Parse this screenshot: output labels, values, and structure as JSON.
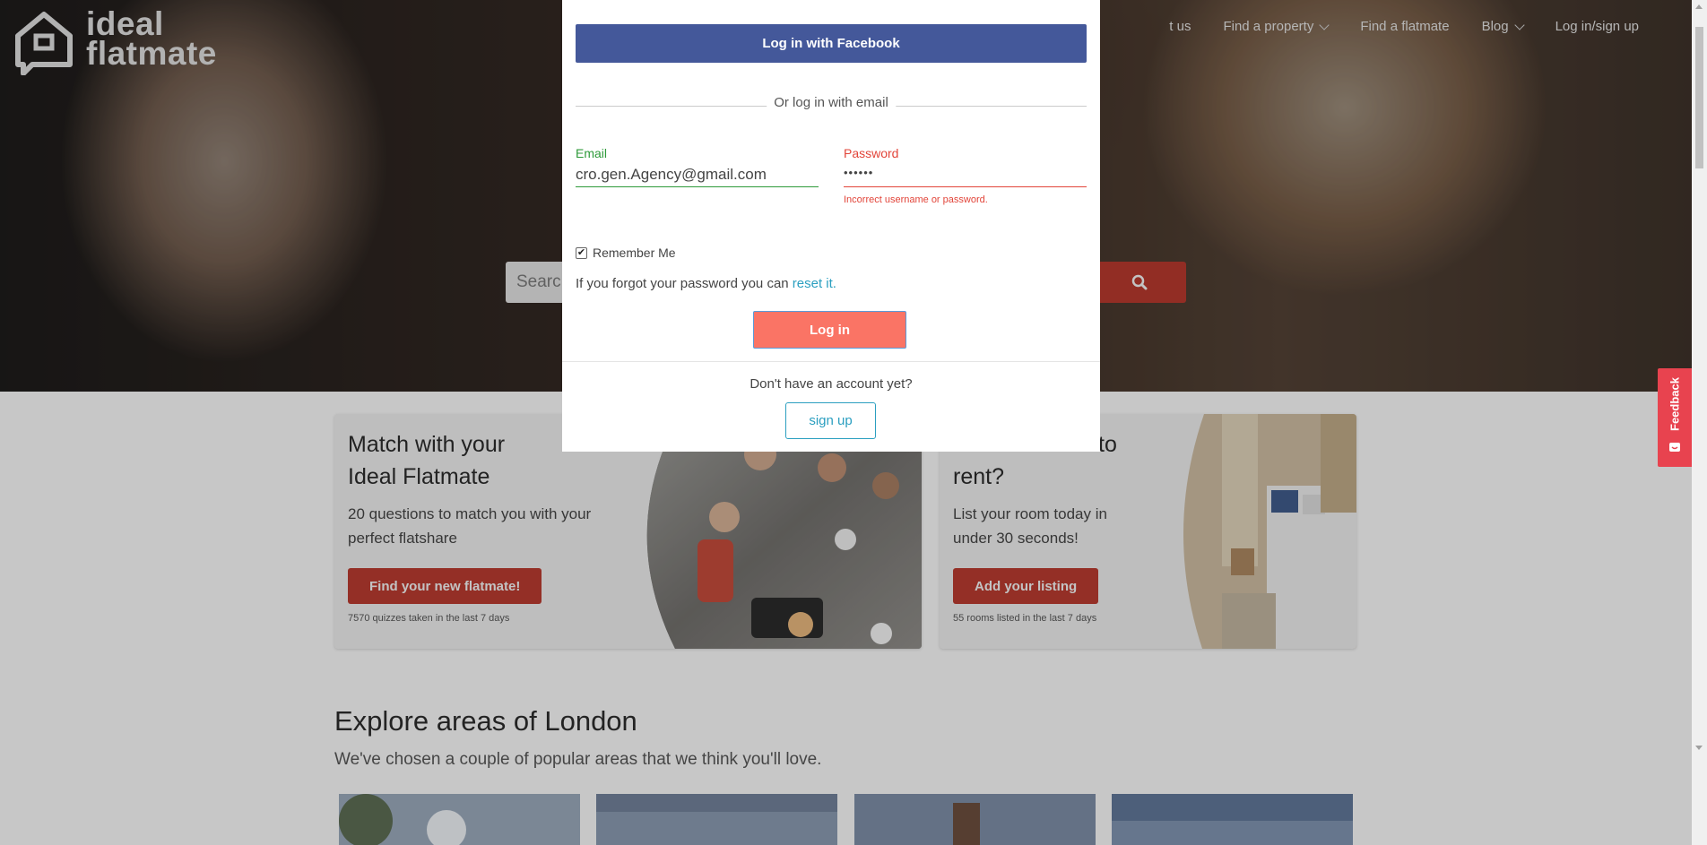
{
  "brand": {
    "logo_line1": "ideal",
    "logo_line2": "flatmate"
  },
  "nav": {
    "items": [
      {
        "label": "t us",
        "dropdown": false
      },
      {
        "label": "Find a property",
        "dropdown": true
      },
      {
        "label": "Find a flatmate",
        "dropdown": false
      },
      {
        "label": "Blog",
        "dropdown": true
      },
      {
        "label": "Log in/sign up",
        "dropdown": false
      }
    ]
  },
  "search": {
    "placeholder": "Searc"
  },
  "login_modal": {
    "facebook_label": "Log in with Facebook",
    "divider_text": "Or log in with email",
    "email_label": "Email",
    "email_value": "cro.gen.Agency@gmail.com",
    "password_label": "Password",
    "password_value": "••••••",
    "password_error": "Incorrect username or password.",
    "remember_label": "Remember Me",
    "remember_checked": true,
    "forgot_text": "If you forgot your password you can ",
    "forgot_link": "reset it.",
    "login_label": "Log in",
    "no_account_text": "Don't have an account yet?",
    "signup_label": "sign up"
  },
  "cards": [
    {
      "title_line1": "Match with your",
      "title_line2": "Ideal Flatmate",
      "desc_line1": "20 questions to match you with your",
      "desc_line2": "perfect flatshare",
      "button": "Find your new flatmate!",
      "note": "7570 quizzes taken in the last 7 days"
    },
    {
      "title_line1": "to",
      "title_line2": "rent?",
      "desc_line1": "List your room today in",
      "desc_line2": "under 30 seconds!",
      "button": "Add your listing",
      "note": "55 rooms listed in the last 7 days"
    }
  ],
  "explore": {
    "title": "Explore areas of London",
    "subtitle": "We've chosen a couple of popular areas that we think you'll love."
  },
  "feedback": {
    "label": "Feedback"
  },
  "colors": {
    "facebook": "#44589a",
    "login_button": "#fa7465",
    "accent_red": "#b53a2f",
    "link_blue": "#2b9fc0",
    "email_green": "#2e9a3a",
    "error_red": "#e2453a",
    "feedback_tab": "#e8434f"
  }
}
